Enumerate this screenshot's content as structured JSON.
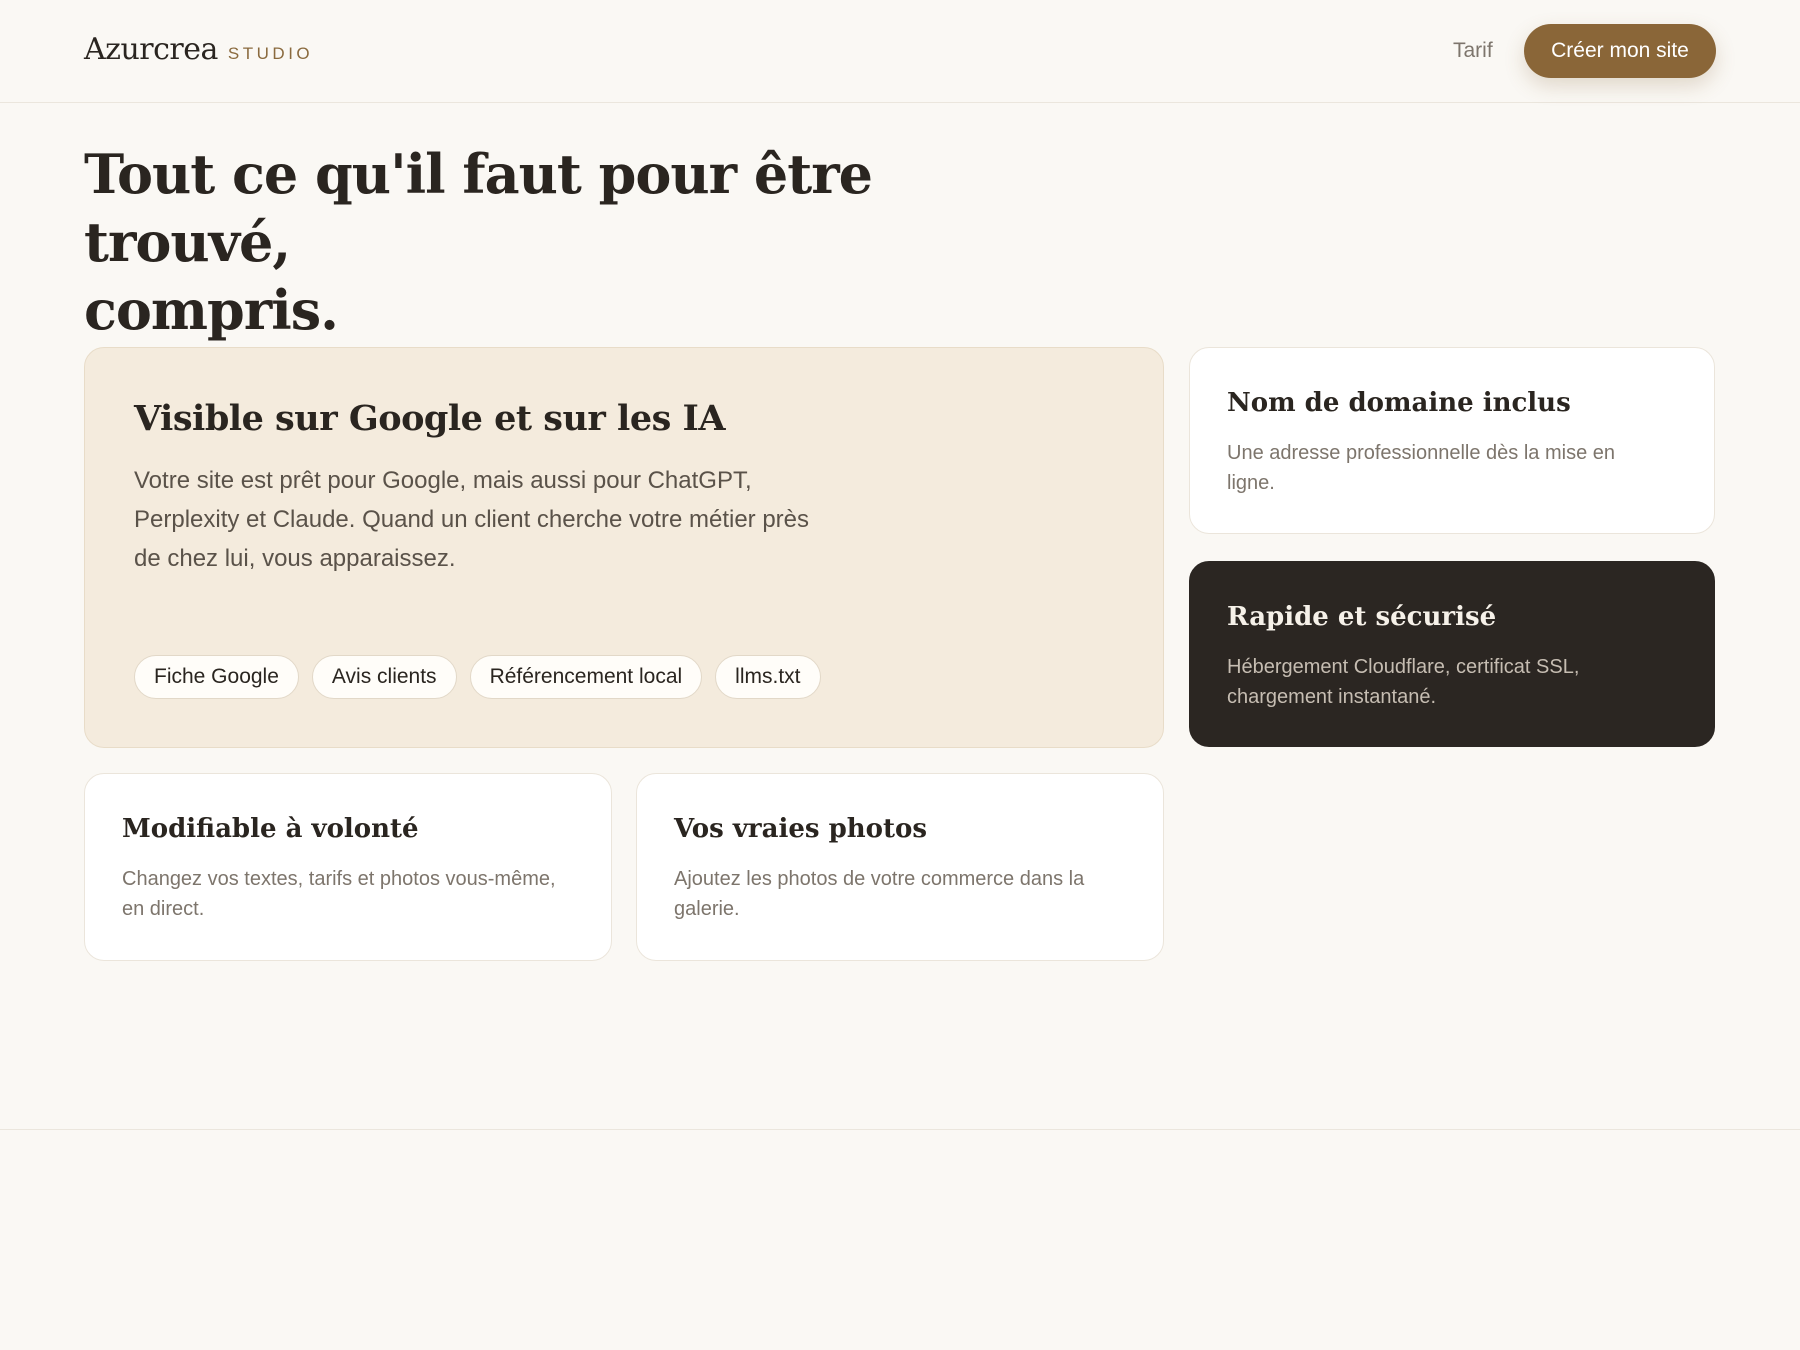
{
  "header": {
    "brand_name": "Azurcrea",
    "brand_tag": "STUDIO",
    "nav_pricing": "Tarif",
    "cta_label": "Créer mon site"
  },
  "hero": {
    "title_line1": "Tout ce qu'il faut pour être trouvé,",
    "title_line2": "compris."
  },
  "feature": {
    "title": "Visible sur Google et sur les IA",
    "description": "Votre site est prêt pour Google, mais aussi pour ChatGPT, Perplexity et Claude. Quand un client cherche votre métier près de chez lui, vous apparaissez.",
    "tags": [
      "Fiche Google",
      "Avis clients",
      "Référencement local",
      "llms.txt"
    ]
  },
  "cards": [
    {
      "title": "Nom de domaine inclus",
      "description": "Une adresse professionnelle dès la mise en ligne."
    },
    {
      "title": "Rapide et sécurisé",
      "description": "Hébergement Cloudflare, certificat SSL, chargement instantané."
    },
    {
      "title": "Modifiable à volonté",
      "description": "Changez vos textes, tarifs et photos vous-même, en direct."
    },
    {
      "title": "Vos vraies photos",
      "description": "Ajoutez les photos de votre commerce dans la galerie."
    }
  ],
  "colors": {
    "background": "#faf8f4",
    "accent": "#8a6638",
    "feature_card": "#f4ebdd",
    "dark_card": "#2b2622",
    "text_primary": "#2a2520",
    "text_muted": "#7d756c"
  }
}
